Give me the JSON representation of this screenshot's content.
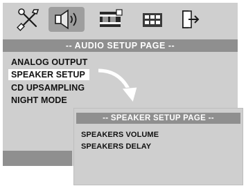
{
  "tabs": [
    {
      "icon": "wrench-screwdriver-icon"
    },
    {
      "icon": "speaker-icon",
      "selected": true
    },
    {
      "icon": "film-strip-icon"
    },
    {
      "icon": "grid-icon"
    },
    {
      "icon": "exit-icon"
    }
  ],
  "audio_page": {
    "title": "-- AUDIO SETUP PAGE --",
    "items": [
      {
        "label": "ANALOG OUTPUT"
      },
      {
        "label": "SPEAKER SETUP",
        "selected": true
      },
      {
        "label": "CD UPSAMPLING"
      },
      {
        "label": "NIGHT MODE"
      }
    ]
  },
  "speaker_page": {
    "title": "-- SPEAKER SETUP PAGE --",
    "items": [
      {
        "label": "SPEAKERS VOLUME"
      },
      {
        "label": "SPEAKERS DELAY"
      }
    ]
  },
  "colors": {
    "panel": "#cfcfcf",
    "title_bar": "#8f8f8f",
    "highlight": "#ffffff"
  }
}
